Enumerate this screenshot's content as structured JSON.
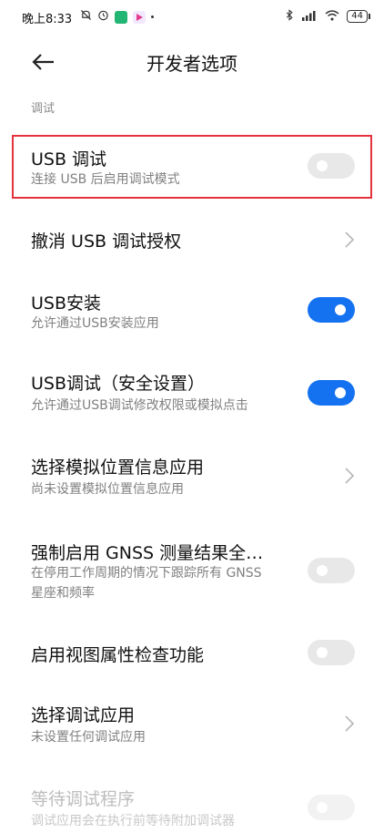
{
  "status_bar": {
    "time": "晚上8:33",
    "battery": "44"
  },
  "header": {
    "title": "开发者选项"
  },
  "section": {
    "label": "调试"
  },
  "rows": [
    {
      "title": "USB 调试",
      "subtitle": "连接 USB 后启用调试模式",
      "control": "toggle",
      "on": false,
      "highlighted": true
    },
    {
      "title": "撤消 USB 调试授权",
      "subtitle": "",
      "control": "chevron"
    },
    {
      "title": "USB安装",
      "subtitle": "允许通过USB安装应用",
      "control": "toggle",
      "on": true
    },
    {
      "title": "USB调试（安全设置）",
      "subtitle": "允许通过USB调试修改权限或模拟点击",
      "control": "toggle",
      "on": true
    },
    {
      "title": "选择模拟位置信息应用",
      "subtitle": "尚未设置模拟位置信息应用",
      "control": "chevron"
    },
    {
      "title": "强制启用 GNSS 测量结果全…",
      "subtitle": "在停用工作周期的情况下跟踪所有 GNSS 星座和频率",
      "control": "toggle",
      "on": false
    },
    {
      "title": "启用视图属性检查功能",
      "subtitle": "",
      "control": "toggle",
      "on": false
    },
    {
      "title": "选择调试应用",
      "subtitle": "未设置任何调试应用",
      "control": "chevron"
    },
    {
      "title": "等待调试程序",
      "subtitle": "调试应用会在执行前等待附加调试器",
      "control": "toggle",
      "on": false,
      "disabled": true
    }
  ],
  "colors": {
    "toggle_on": "#1472f1",
    "toggle_off": "#e8e8e8",
    "highlight": "#e5323c"
  }
}
